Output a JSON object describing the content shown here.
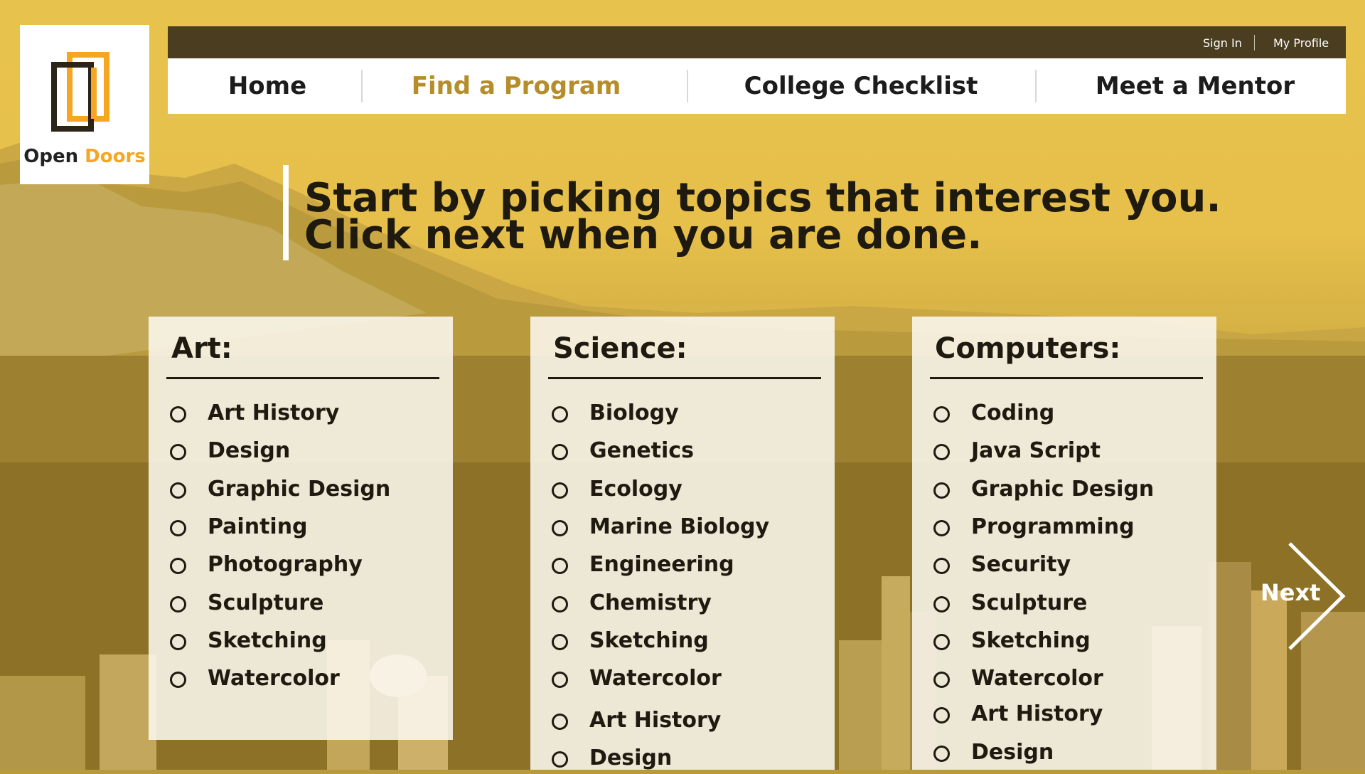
{
  "brand": {
    "name_part1": "Open",
    "name_part2": "Doors",
    "accent_color": "#f5a623",
    "dark_color": "#2b2418"
  },
  "utility": {
    "sign_in": "Sign In",
    "my_profile": "My Profile"
  },
  "nav": {
    "items": [
      {
        "label": "Home",
        "active": false
      },
      {
        "label": "Find a Program",
        "active": true
      },
      {
        "label": "College Checklist",
        "active": false
      },
      {
        "label": "Meet a Mentor",
        "active": false
      }
    ]
  },
  "headline": {
    "line1": "Start by picking topics that interest you.",
    "line2": "Click next when you are done."
  },
  "categories": [
    {
      "title": "Art:",
      "items": [
        "Art History",
        "Design",
        "Graphic Design",
        "Painting",
        "Photography",
        "Sculpture",
        "Sketching",
        "Watercolor"
      ]
    },
    {
      "title": "Science:",
      "items": [
        "Biology",
        "Genetics",
        "Ecology",
        "Marine Biology",
        "Engineering",
        "Chemistry",
        "Sketching",
        "Watercolor",
        "Art History",
        "Design"
      ]
    },
    {
      "title": "Computers:",
      "items": [
        "Coding",
        "Java Script",
        "Graphic Design",
        "Programming",
        "Security",
        "Sculpture",
        "Sketching",
        "Watercolor",
        "Art History",
        "Design"
      ]
    }
  ],
  "next": {
    "label": "Next",
    "icon": "chevron-right-icon"
  },
  "colors": {
    "nav_dark": "#4a3d20",
    "active_link": "#b58d2a",
    "background_gold": "#e6c04a"
  }
}
